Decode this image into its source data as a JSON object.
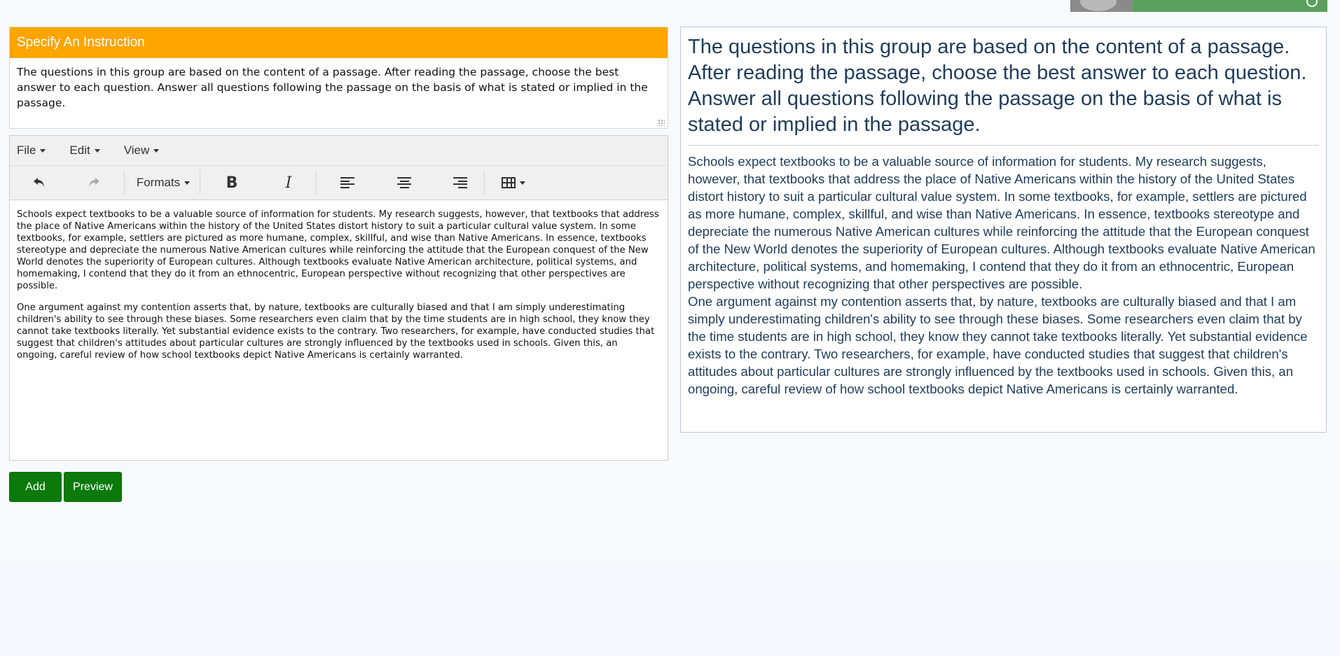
{
  "instruction": {
    "header": "Specify An Instruction",
    "text": "The questions in this group are based on the content of a passage. After reading the passage, choose the best answer to each question. Answer all questions following the passage on the basis of what is stated or implied in the passage."
  },
  "editor": {
    "menu": {
      "file": "File",
      "edit": "Edit",
      "view": "View"
    },
    "toolbar": {
      "formats": "Formats",
      "bold": "B",
      "italic": "I",
      "icons": [
        "undo-icon",
        "redo-icon",
        "align-left-icon",
        "align-center-icon",
        "align-right-icon",
        "table-icon"
      ]
    },
    "paragraphs": [
      "Schools expect textbooks to be a valuable source of information for students. My research suggests, however, that textbooks that address the place of Native Americans within the history of the United States distort history to suit a particular cultural value system. In some textbooks, for example, settlers are pictured as more humane, complex, skillful, and wise than Native Americans. In essence, textbooks stereotype and depreciate the numerous Native American cultures while reinforcing the attitude that the European conquest of the New World denotes the superiority of European cultures. Although textbooks evaluate Native American architecture, political systems, and homemaking, I contend that they do it from an ethnocentric, European perspective without recognizing that other perspectives are possible.",
      "One argument against my contention asserts that, by nature, textbooks are culturally biased and that I am simply underestimating children's ability to see through these biases. Some researchers even claim that by the time students are in high school, they know they cannot take textbooks literally. Yet substantial evidence exists to the contrary. Two researchers, for example, have conducted studies that suggest that children's attitudes about particular cultures are strongly influenced by the textbooks used in schools. Given this, an ongoing, careful review of how school textbooks depict Native Americans is certainly warranted."
    ]
  },
  "buttons": {
    "add": "Add",
    "preview": "Preview"
  },
  "preview": {
    "title": "The questions in this group are based on the content of a passage. After reading the passage, choose the best answer to each question. Answer all questions following the passage on the basis of what is stated or implied in the passage.",
    "paragraphs": [
      "Schools expect textbooks to be a valuable source of information for students. My research suggests, however, that textbooks that address the place of Native Americans within the history of the United States distort history to suit a particular cultural value system. In some textbooks, for example, settlers are pictured as more humane, complex, skillful, and wise than Native Americans. In essence, textbooks stereotype and depreciate the numerous Native American cultures while reinforcing the attitude that the European conquest of the New World denotes the superiority of European cultures. Although textbooks evaluate Native American architecture, political systems, and homemaking, I contend that they do it from an ethnocentric, European perspective without recognizing that other perspectives are possible.",
      "One argument against my contention asserts that, by nature, textbooks are culturally biased and that I am simply underestimating children's ability to see through these biases. Some researchers even claim that by the time students are in high school, they know they cannot take textbooks literally. Yet substantial evidence exists to the contrary. Two researchers, for example, have conducted studies that suggest that children's attitudes about particular cultures are strongly influenced by the textbooks used in schools. Given this, an ongoing, careful review of how school textbooks depict Native Americans is certainly warranted."
    ]
  },
  "colors": {
    "header_orange": "#ffa500",
    "button_green": "#0a7a0a",
    "preview_text": "#1f3c5a",
    "topbar_green": "#5aa05c"
  }
}
